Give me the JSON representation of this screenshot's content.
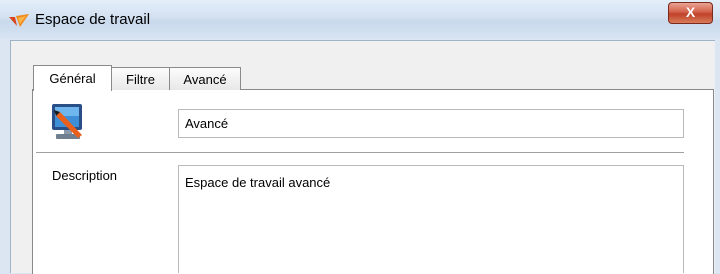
{
  "window": {
    "title": "Espace de travail",
    "close_label": "X"
  },
  "tabs": [
    {
      "label": "Général"
    },
    {
      "label": "Filtre"
    },
    {
      "label": "Avancé"
    }
  ],
  "general": {
    "name_value": "Avancé",
    "description_label": "Description",
    "description_value": "Espace de travail avancé"
  },
  "icons": {
    "app": "workspace-logo-icon",
    "workspace": "workspace-monitor-icon"
  },
  "colors": {
    "title_bar": "#d3e1f1",
    "close_button": "#c04128",
    "client": "#f0f0f0"
  }
}
